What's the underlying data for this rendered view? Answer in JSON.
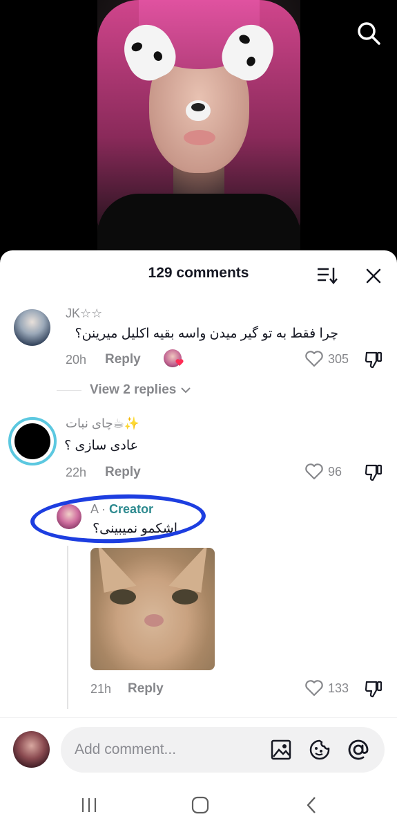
{
  "header": {
    "title": "129 comments"
  },
  "comments": [
    {
      "username": "JK☆☆",
      "text": "چرا فقط به تو گیر میدن واسه بقیه اکلیل میرینن؟",
      "time": "20h",
      "reply_label": "Reply",
      "likes": "305",
      "view_replies": "View 2 replies"
    },
    {
      "username": "چای نبات☕✨",
      "text": "عادی سازی ؟",
      "time": "22h",
      "reply_label": "Reply",
      "likes": "96"
    }
  ],
  "reply": {
    "username": "A",
    "separator": "·",
    "creator_label": "Creator",
    "text": "اشکمو نمیبینی؟",
    "time": "21h",
    "reply_label": "Reply",
    "likes": "133"
  },
  "input": {
    "placeholder": "Add comment..."
  },
  "colors": {
    "creator": "#2d8a8f",
    "annotation_circle": "#1d3ee0",
    "like_badge": "#fe2c55"
  },
  "icons": [
    "search-icon",
    "sort-icon",
    "close-icon",
    "heart-icon",
    "dislike-icon",
    "image-icon",
    "emoji-icon",
    "mention-icon",
    "nav-recents-icon",
    "nav-home-icon",
    "nav-back-icon"
  ]
}
